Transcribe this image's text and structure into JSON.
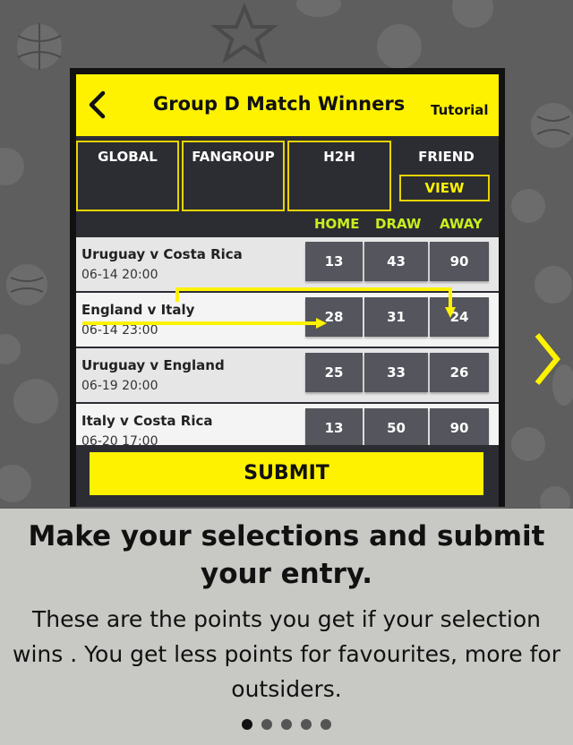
{
  "header": {
    "title": "Group D Match Winners",
    "tutorial_label": "Tutorial"
  },
  "tabs": [
    {
      "label": "GLOBAL"
    },
    {
      "label": "FANGROUP"
    },
    {
      "label": "H2H"
    }
  ],
  "friend": {
    "label": "FRIEND",
    "view_label": "VIEW"
  },
  "columns": {
    "home": "HOME",
    "draw": "DRAW",
    "away": "AWAY"
  },
  "matches": [
    {
      "teams": "Uruguay v Costa Rica",
      "date": "06-14 20:00",
      "home": "13",
      "draw": "43",
      "away": "90"
    },
    {
      "teams": "England v Italy",
      "date": "06-14 23:00",
      "home": "28",
      "draw": "31",
      "away": "24"
    },
    {
      "teams": "Uruguay v England",
      "date": "06-19 20:00",
      "home": "25",
      "draw": "33",
      "away": "26"
    },
    {
      "teams": "Italy v Costa Rica",
      "date": "06-20 17:00",
      "home": "13",
      "draw": "50",
      "away": "90"
    }
  ],
  "submit_label": "SUBMIT",
  "caption": {
    "title": "Make your selections and submit your entry.",
    "body": "These are the points you get if your selection wins . You get less points for favourites, more for outsiders."
  },
  "pagination": {
    "total": 5,
    "current": 1
  },
  "colors": {
    "accent": "#fff200",
    "column_header": "#c8ef1e",
    "odds_button": "#54555d"
  }
}
